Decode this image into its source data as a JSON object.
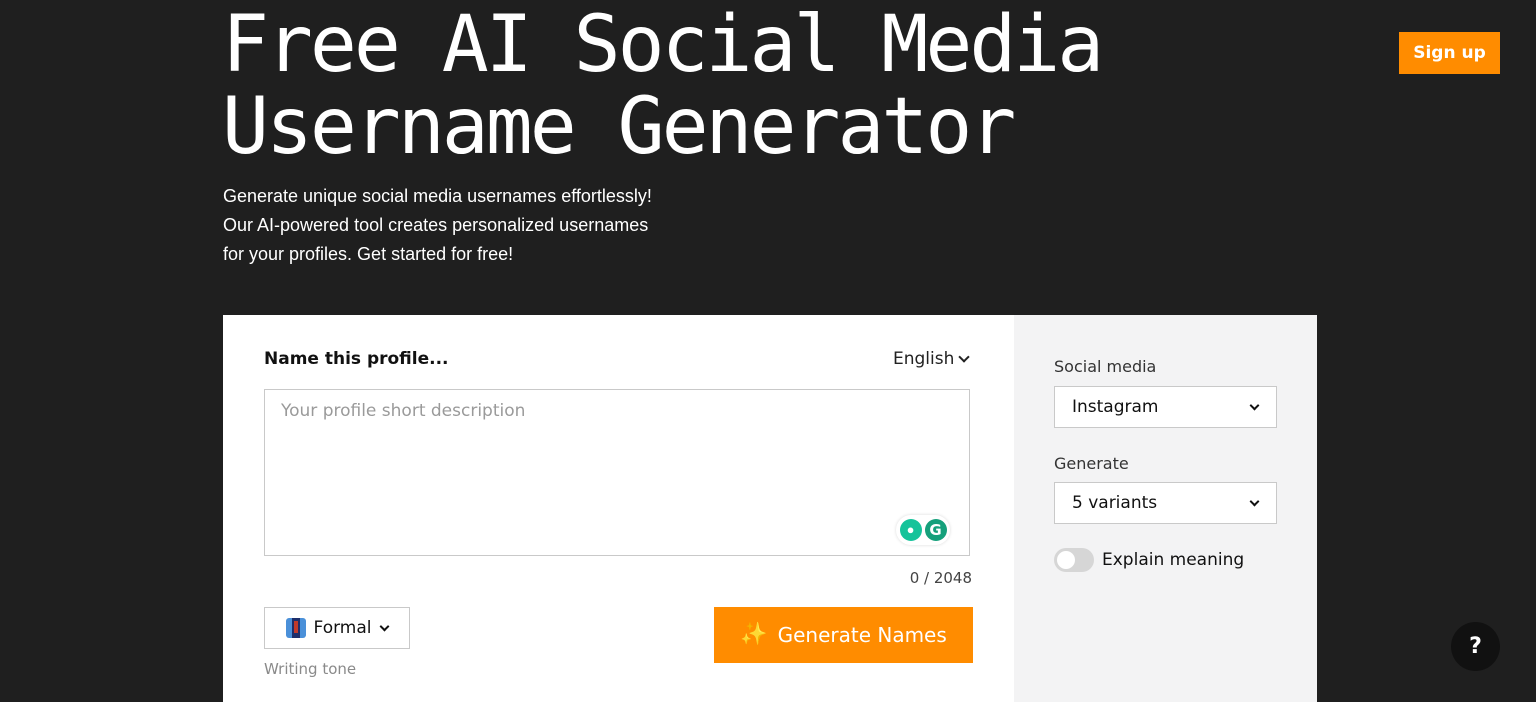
{
  "header": {
    "title_line1": "Free AI Social Media",
    "title_line2": "Username Generator",
    "subtitle_line1": "Generate unique social media usernames effortlessly!",
    "subtitle_line2": "Our AI-powered tool creates personalized usernames",
    "subtitle_line3": "for your profiles. Get started for free!",
    "signup_label": "Sign up"
  },
  "form": {
    "label": "Name this profile...",
    "language": "English",
    "description_value": "",
    "description_placeholder": "Your profile short description",
    "char_count": "0 / 2048",
    "tone_value": "Formal",
    "tone_caption": "Writing tone",
    "generate_label": "Generate Names"
  },
  "options": {
    "social_media_label": "Social media",
    "social_media_value": "Instagram",
    "generate_label": "Generate",
    "generate_value": "5 variants",
    "explain_label": "Explain meaning",
    "explain_enabled": false
  },
  "help": {
    "label": "?"
  },
  "icons": {
    "sparkle": "sparkle-icon",
    "tone": "necktie-icon",
    "chevron": "chevron-down-icon",
    "grammarly": "grammarly-icon",
    "help": "question-icon"
  },
  "colors": {
    "background": "#1f1f1f",
    "accent": "#ff8c00",
    "panel": "#f3f3f4",
    "card": "#ffffff"
  }
}
